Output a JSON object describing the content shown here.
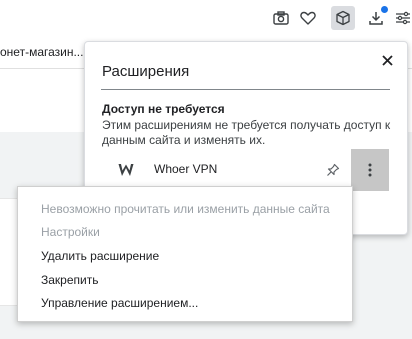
{
  "toolbar": {
    "icons": [
      "camera-icon",
      "heart-icon",
      "extensions-cube-icon",
      "download-icon",
      "customize-menu-icon"
    ],
    "download_badge_color": "#1a73e8"
  },
  "bookmarks": {
    "item": "онет-магазин..."
  },
  "extensions_popup": {
    "title": "Расширения",
    "section_title": "Доступ не требуется",
    "section_desc": "Этим расширениям не требуется получать доступ к данным сайта и изменять их.",
    "extension": {
      "name": "Whoer VPN",
      "logo_letter": "W"
    }
  },
  "context_menu": {
    "items": [
      {
        "label": "Невозможно прочитать или изменить данные сайта",
        "disabled": true
      },
      {
        "label": "Настройки",
        "disabled": true
      },
      {
        "label": "Удалить расширение",
        "disabled": false
      },
      {
        "label": "Закрепить",
        "disabled": false
      },
      {
        "label": "Управление расширением...",
        "disabled": false
      }
    ]
  }
}
